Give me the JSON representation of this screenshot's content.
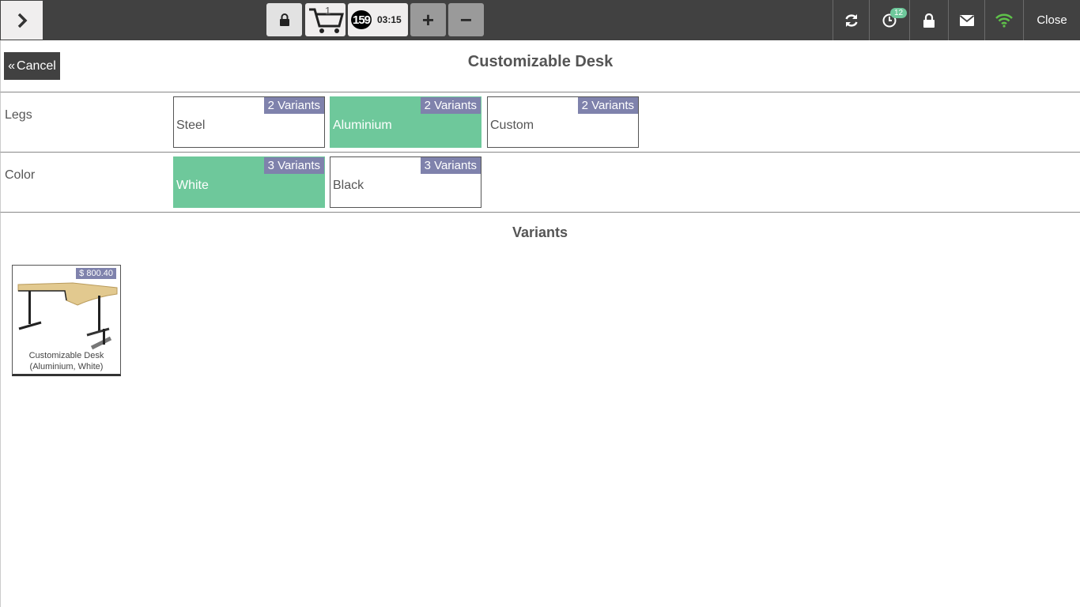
{
  "topbar": {
    "cart_count": "1",
    "order_number": "159",
    "order_time": "03:15",
    "notification_count": "12",
    "close_label": "Close"
  },
  "header": {
    "cancel_label": "Cancel",
    "title": "Customizable Desk"
  },
  "attributes": [
    {
      "label": "Legs",
      "options": [
        {
          "name": "Steel",
          "badge": "2 Variants",
          "selected": false
        },
        {
          "name": "Aluminium",
          "badge": "2 Variants",
          "selected": true
        },
        {
          "name": "Custom",
          "badge": "2 Variants",
          "selected": false
        }
      ]
    },
    {
      "label": "Color",
      "options": [
        {
          "name": "White",
          "badge": "3 Variants",
          "selected": true
        },
        {
          "name": "Black",
          "badge": "3 Variants",
          "selected": false
        }
      ]
    }
  ],
  "variants": {
    "title": "Variants",
    "products": [
      {
        "price": "$ 800.40",
        "name_line1": "Customizable Desk",
        "name_line2": "(Aluminium, White)"
      }
    ]
  },
  "colors": {
    "selected": "#6ec89b",
    "badge": "#7f82ac",
    "topbar": "#414141"
  }
}
